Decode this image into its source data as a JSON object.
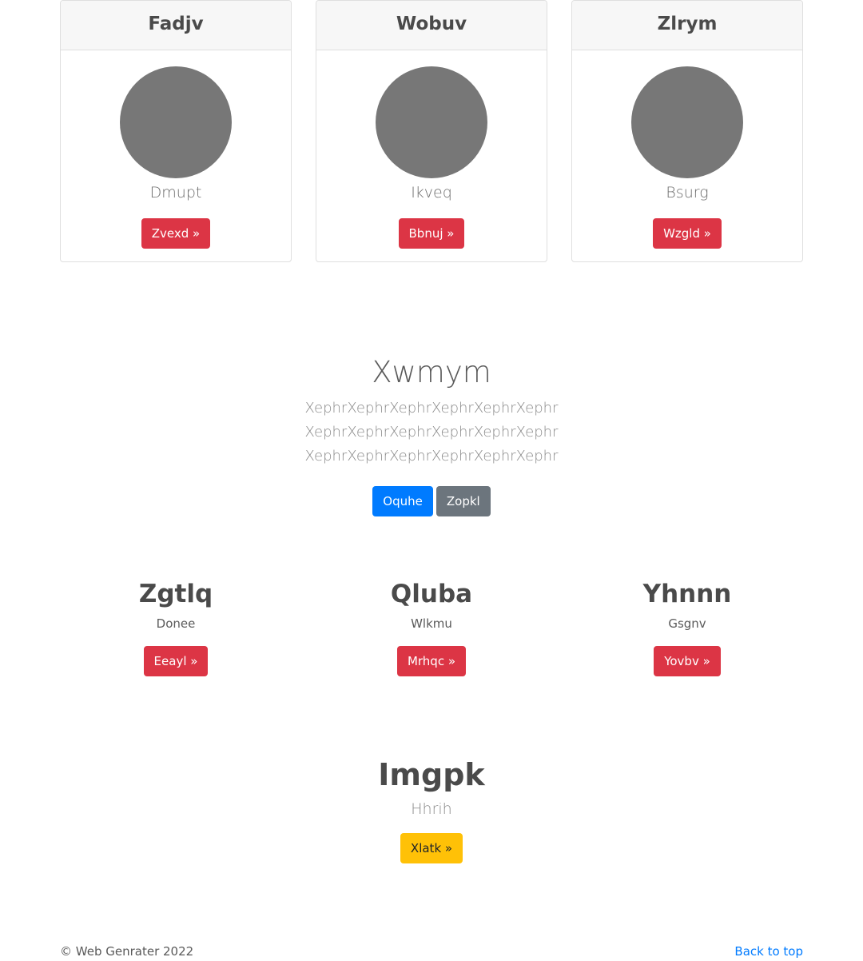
{
  "cards": [
    {
      "title": "Fadjv",
      "text": "Dmupt",
      "button": "Zvexd »"
    },
    {
      "title": "Wobuv",
      "text": "Ikveq",
      "button": "Bbnuj »"
    },
    {
      "title": "Zlrym",
      "text": "Bsurg",
      "button": "Wzgld »"
    }
  ],
  "hero": {
    "title": "Xwmym",
    "lead": "XephrXephrXephrXephrXephrXephr XephrXephrXephrXephrXephrXephr XephrXephrXephrXephrXephrXephr",
    "primary_button": "Oquhe",
    "secondary_button": "Zopkl"
  },
  "columns": [
    {
      "title": "Zgtlq",
      "text": "Donee",
      "button": "Eeayl »"
    },
    {
      "title": "Qluba",
      "text": "Wlkmu",
      "button": "Mrhqc »"
    },
    {
      "title": "Yhnnn",
      "text": "Gsgnv",
      "button": "Yovbv »"
    }
  ],
  "feature": {
    "title": "Imgpk",
    "text": "Hhrih",
    "button": "Xlatk »"
  },
  "footer": {
    "copyright": "© Web Genrater 2022",
    "back_to_top": "Back to top"
  },
  "colors": {
    "danger": "#dc3545",
    "primary": "#007bff",
    "secondary": "#6c757d",
    "warning": "#ffc107",
    "avatar": "#777777"
  }
}
